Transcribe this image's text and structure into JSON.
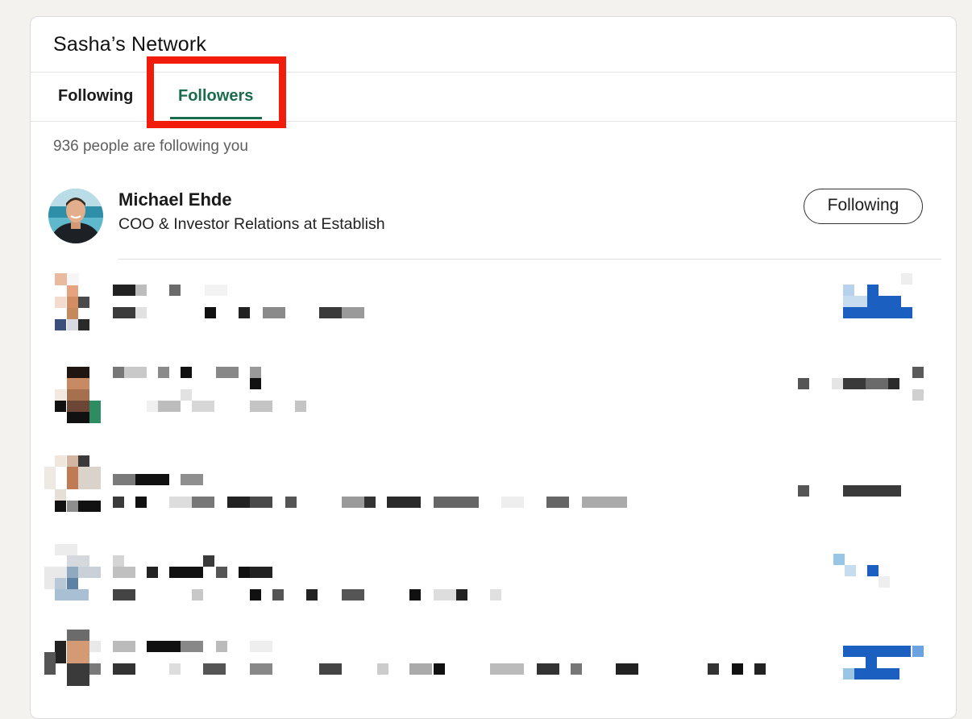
{
  "network": {
    "title": "Sasha’s Network"
  },
  "tabs": [
    {
      "label": "Following"
    },
    {
      "label": "Followers"
    }
  ],
  "followers": {
    "count_text": "936 people are following you",
    "first": {
      "name": "Michael Ehde",
      "headline": "COO & Investor Relations at Establish",
      "button_label": "Following"
    }
  },
  "colors": {
    "active_tab": "#1b6c4c",
    "highlight_box": "#f21c0c"
  }
}
